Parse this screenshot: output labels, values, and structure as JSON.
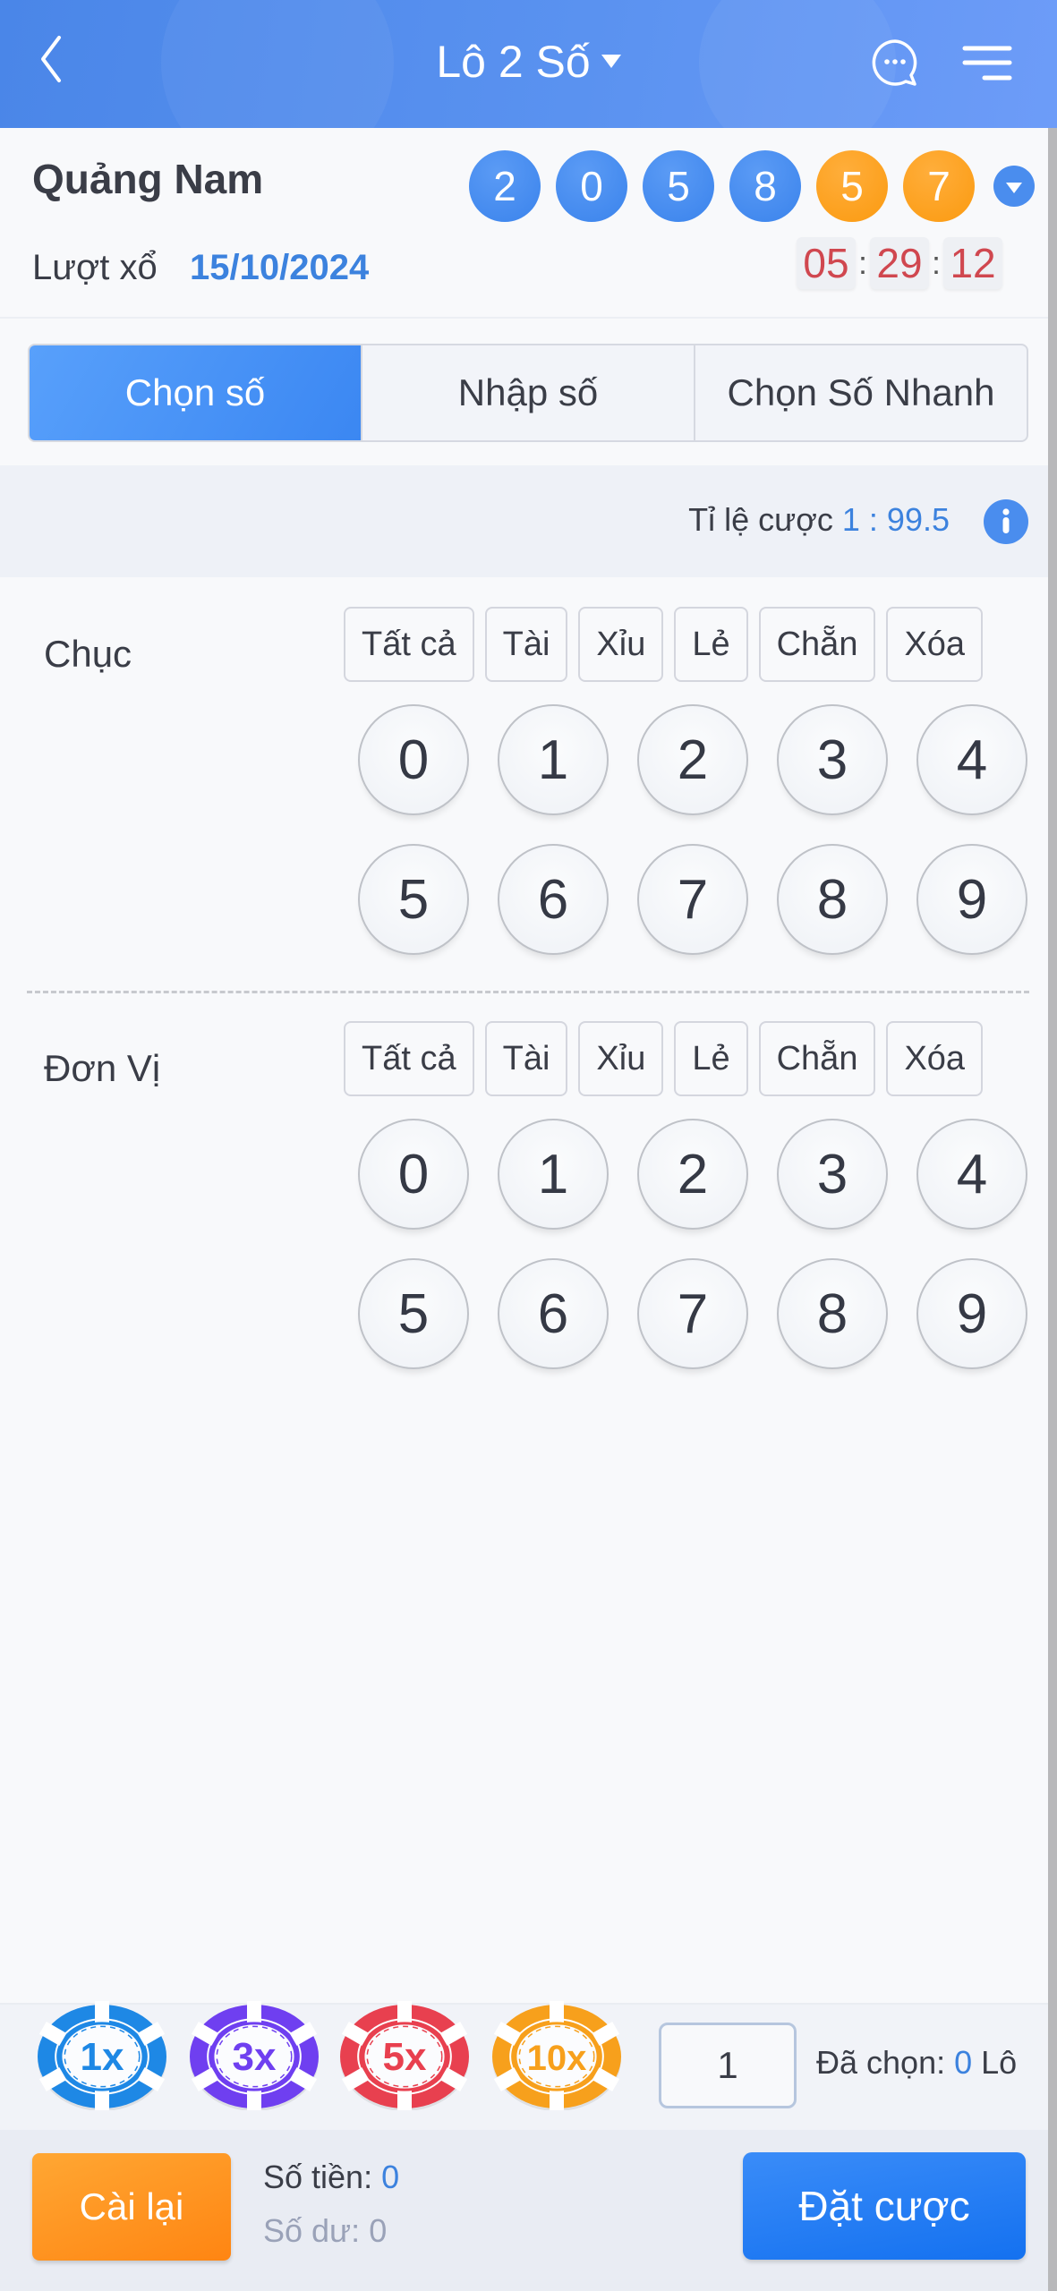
{
  "header": {
    "title": "Lô 2 Số",
    "back_icon": "chevron-left-icon",
    "chat_icon": "chat-bubble-icon",
    "menu_icon": "menu-icon"
  },
  "draw_info": {
    "province": "Quảng Nam",
    "draw_label": "Lượt xổ",
    "draw_date": "15/10/2024",
    "result_balls": [
      {
        "value": "2",
        "color": "blue"
      },
      {
        "value": "0",
        "color": "blue"
      },
      {
        "value": "5",
        "color": "blue"
      },
      {
        "value": "8",
        "color": "blue"
      },
      {
        "value": "5",
        "color": "orange"
      },
      {
        "value": "7",
        "color": "orange"
      }
    ],
    "countdown": {
      "hours": "05",
      "minutes": "29",
      "seconds": "12",
      "separator": ":"
    }
  },
  "tabs": [
    {
      "label": "Chọn số",
      "active": true
    },
    {
      "label": "Nhập số",
      "active": false
    },
    {
      "label": "Chọn Số Nhanh",
      "active": false
    }
  ],
  "odds": {
    "label": "Tỉ lệ cược",
    "value": "1 : 99.5"
  },
  "picker": {
    "quick_buttons": [
      "Tất cả",
      "Tài",
      "Xỉu",
      "Lẻ",
      "Chẵn",
      "Xóa"
    ],
    "sections": [
      {
        "label": "Chục",
        "numbers": [
          "0",
          "1",
          "2",
          "3",
          "4",
          "5",
          "6",
          "7",
          "8",
          "9"
        ]
      },
      {
        "label": "Đơn Vị",
        "numbers": [
          "0",
          "1",
          "2",
          "3",
          "4",
          "5",
          "6",
          "7",
          "8",
          "9"
        ]
      }
    ]
  },
  "chips": [
    {
      "label": "1x",
      "color": "#1e88e5"
    },
    {
      "label": "3x",
      "color": "#6f3ff0"
    },
    {
      "label": "5x",
      "color": "#e8404f"
    },
    {
      "label": "10x",
      "color": "#f7a01c"
    }
  ],
  "bet_bar": {
    "multiplier_value": "1",
    "selected_label": "Đã chọn:",
    "selected_count": "0",
    "selected_unit": "Lô"
  },
  "footer": {
    "reset_label": "Cài lại",
    "amount_label": "Số tiền:",
    "amount_value": "0",
    "balance_label": "Số dư:",
    "balance_value": "0",
    "bet_label": "Đặt cược"
  },
  "colors": {
    "accent_blue": "#3c82de",
    "header_blue": "#5a92f0",
    "ball_orange": "#fb9a10",
    "timer_red": "#d0474f",
    "reset_orange": "#ff8a14",
    "bet_blue": "#1f78f2"
  }
}
